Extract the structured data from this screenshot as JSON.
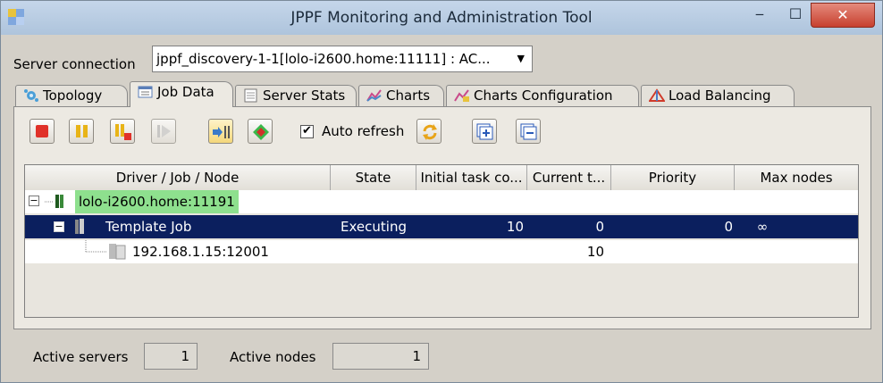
{
  "window": {
    "title": "JPPF Monitoring and Administration Tool",
    "minimize": "‒",
    "maximize": "☐",
    "close": "✕"
  },
  "connection": {
    "label": "Server connection",
    "value": "jppf_discovery-1-1[lolo-i2600.home:11111] : AC...",
    "arrow": "▼"
  },
  "tabs": [
    {
      "label": "Topology",
      "icon": "topology-icon"
    },
    {
      "label": "Job Data",
      "icon": "job-data-icon"
    },
    {
      "label": "Server Stats",
      "icon": "server-stats-icon"
    },
    {
      "label": "Charts",
      "icon": "charts-icon"
    },
    {
      "label": "Charts Configuration",
      "icon": "charts-config-icon"
    },
    {
      "label": "Load Balancing",
      "icon": "load-balancing-icon"
    }
  ],
  "toolbar": {
    "auto_refresh_label": "Auto refresh",
    "auto_refresh_checked": "✔"
  },
  "table": {
    "columns": [
      "Driver / Job / Node",
      "State",
      "Initial task co...",
      "Current t...",
      "Priority",
      "Max nodes"
    ],
    "rows": [
      {
        "name": "lolo-i2600.home:11191",
        "state": "",
        "initial": "",
        "current": "",
        "priority": "",
        "max": ""
      },
      {
        "name": "Template Job",
        "state": "Executing",
        "initial": "10",
        "current": "0",
        "priority": "0",
        "max": "∞"
      },
      {
        "name": "192.168.1.15:12001",
        "state": "",
        "initial": "",
        "current": "10",
        "priority": "",
        "max": ""
      }
    ]
  },
  "status": {
    "active_servers_label": "Active servers",
    "active_servers": "1",
    "active_nodes_label": "Active nodes",
    "active_nodes": "1"
  },
  "colors": {
    "highlight_driver": "#8ee08e",
    "selected_row": "#0b1f5e"
  }
}
